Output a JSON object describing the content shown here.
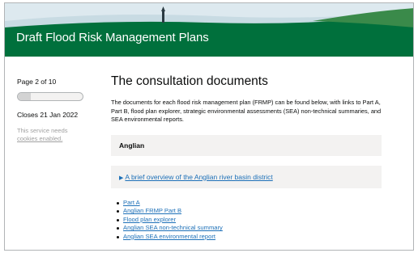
{
  "banner": {
    "title": "Draft Flood Risk Management Plans",
    "colors": {
      "green": "#00703c",
      "sky": "#dde9ef"
    }
  },
  "sidebar": {
    "page_count": "Page 2 of 10",
    "progress_fraction": 0.2,
    "closes": "Closes 21 Jan 2022",
    "service_note": "This service needs",
    "cookies_link": "cookies enabled."
  },
  "main": {
    "heading": "The consultation documents",
    "intro": "The documents for each flood risk management plan (FRMP) can be found below, with links to Part A, Part B, flood plan explorer, strategic environmental assessments (SEA) non-technical summaries, and SEA environmental reports.",
    "region": "Anglian",
    "overview_icon": "triangle-right-icon",
    "overview_link": "A brief overview of the Anglian river basin district",
    "documents": [
      {
        "label": "Part A"
      },
      {
        "label": "Anglian FRMP Part B"
      },
      {
        "label": "Flood plan explorer"
      },
      {
        "label": "Anglian SEA non-technical summary"
      },
      {
        "label": "Anglian SEA environmental report"
      }
    ],
    "link_color": "#1d70b8"
  }
}
